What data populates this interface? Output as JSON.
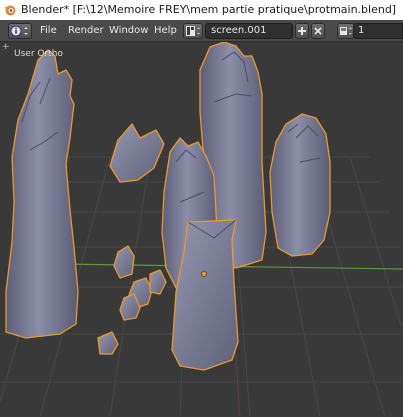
{
  "window": {
    "title": "Blender* [F:\\12\\Memoire FREY\\mem partie pratique\\protmain.blend]"
  },
  "header": {
    "menus": [
      "File",
      "Render",
      "Window",
      "Help"
    ],
    "screen_name": "screen.001",
    "scene_value": "1"
  },
  "viewport": {
    "view_label": "User Ortho"
  },
  "colors": {
    "header_bg": "#4a4a4a",
    "viewport_bg": "#393939",
    "selection_outline": "#e69a2e",
    "mesh_fill": "#7a7c96",
    "x_axis": "#b04a4a",
    "y_axis": "#5b9a3a"
  },
  "icons": [
    "blender-logo-icon",
    "info-editor-icon",
    "screen-layout-icon",
    "add-icon",
    "close-icon",
    "scene-icon",
    "expand-corner-icon"
  ]
}
